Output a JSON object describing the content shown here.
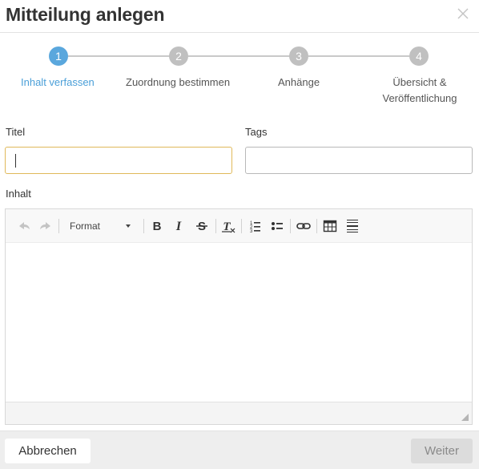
{
  "dialog": {
    "title": "Mitteilung anlegen",
    "close_icon": "close-icon"
  },
  "stepper": {
    "steps": [
      {
        "number": "1",
        "label": "Inhalt verfassen",
        "active": true
      },
      {
        "number": "2",
        "label": "Zuordnung bestimmen",
        "active": false
      },
      {
        "number": "3",
        "label": "Anhänge",
        "active": false
      },
      {
        "number": "4",
        "label_line1": "Übersicht &",
        "label_line2": "Veröffentlichung",
        "active": false
      }
    ],
    "active_color": "#5aa7dd",
    "inactive_color": "#c0c0c0"
  },
  "form": {
    "title_label": "Titel",
    "title_value": "",
    "tags_label": "Tags",
    "tags_value": "",
    "content_label": "Inhalt"
  },
  "toolbar": {
    "items": [
      "undo-icon",
      "redo-icon",
      "format-dropdown",
      "bold-icon",
      "italic-icon",
      "strikethrough-icon",
      "remove-format-icon",
      "numbered-list-icon",
      "bulleted-list-icon",
      "link-icon",
      "table-icon",
      "horizontal-rule-icon"
    ],
    "format_label": "Format"
  },
  "footer": {
    "cancel_label": "Abbrechen",
    "next_label": "Weiter"
  }
}
